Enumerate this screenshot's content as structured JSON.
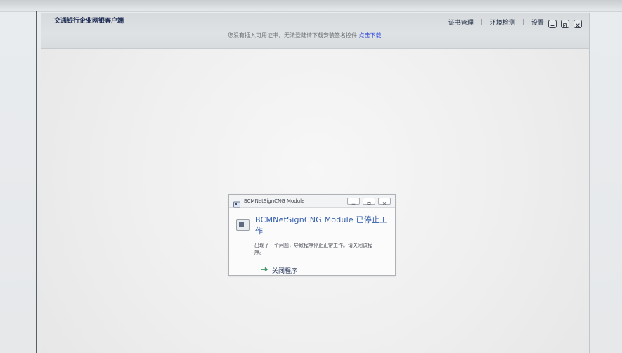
{
  "window": {
    "title": "交通银行企业网银客户端",
    "notice": "您没有插入可用证书，无法登陆请下载安装签名控件",
    "notice_link": "点击下载"
  },
  "header_links": [
    {
      "label": "证书管理"
    },
    {
      "label": "环境检测"
    },
    {
      "label": "设置"
    }
  ],
  "window_controls": [
    {
      "name": "minimize-icon"
    },
    {
      "name": "restore-icon"
    },
    {
      "name": "close-icon"
    }
  ],
  "dialog": {
    "title": "BCMNetSignCNG Module",
    "heading": "BCMNetSignCNG Module 已停止工作",
    "description": "出现了一个问题，导致程序停止正常工作。请关闭该程序。",
    "action": "关闭程序",
    "controls": [
      {
        "name": "dialog-minimize-icon"
      },
      {
        "name": "dialog-maximize-icon"
      },
      {
        "name": "dialog-close-icon"
      }
    ]
  },
  "colors": {
    "accent": "#2f4bd8",
    "title": "#1b2a52",
    "action_arrow": "#2e8b57"
  }
}
